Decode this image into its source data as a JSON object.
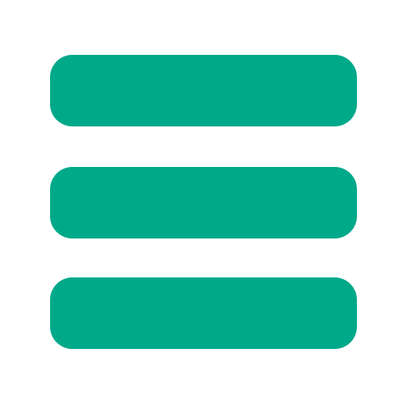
{
  "icon": {
    "name": "hamburger-menu-icon",
    "bar_count": 3
  },
  "colors": {
    "background": "#ffffff",
    "bar": "#00a98a"
  }
}
